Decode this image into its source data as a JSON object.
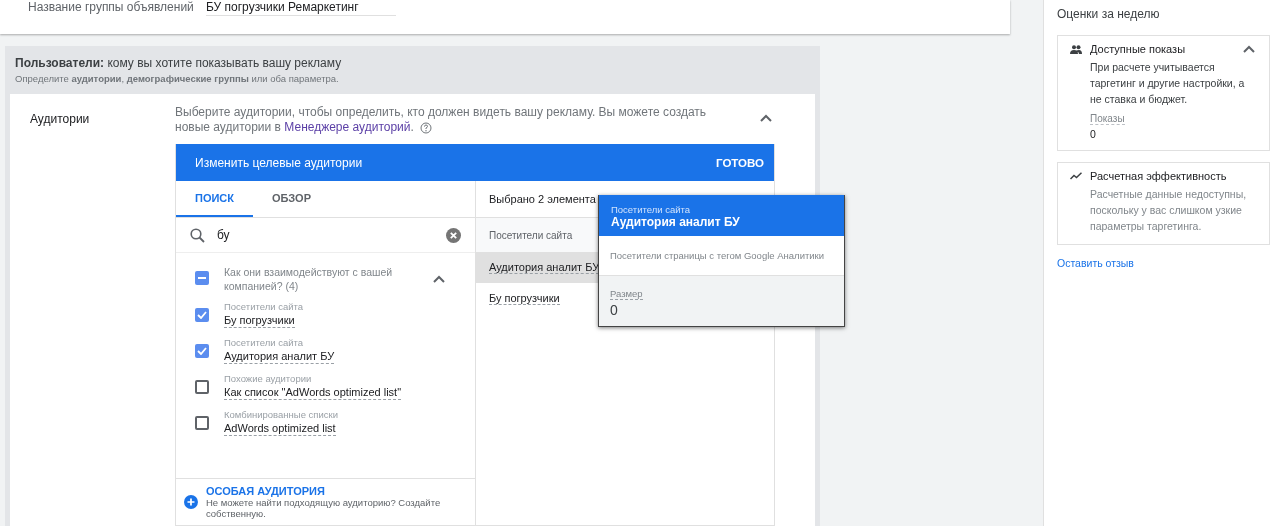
{
  "ad_group": {
    "label": "Название группы объявлений",
    "value": "БУ погрузчики Ремаркетинг"
  },
  "users_section": {
    "title": "**Пользователи:** кому вы хотите показывать вашу рекламу",
    "subtitle": "Определите **аудитории**, **демографические группы** или оба параметра."
  },
  "audiences": {
    "label": "Аудитории",
    "description": "Выберите аудитории, чтобы определить, кто должен видеть вашу рекламу.  Вы можете создать новые аудитории в",
    "link": "Менеджере аудиторий",
    "after_link": ".",
    "expanded": true
  },
  "editor": {
    "title": "Изменить целевые аудитории",
    "done": "ГОТОВО",
    "tabs": [
      {
        "label": "ПОИСК",
        "selected": true
      },
      {
        "label": "ОБЗОР",
        "selected": false
      }
    ],
    "search": {
      "value": "бу"
    },
    "group": {
      "label": "Как они взаимодействуют с вашей компанией? (4)",
      "partial": true,
      "expanded": true
    },
    "items": [
      {
        "category": "Посетители сайта",
        "name": "Бу погрузчики",
        "checked": true
      },
      {
        "category": "Посетители сайта",
        "name": "Аудитория аналит БУ",
        "checked": true
      },
      {
        "category": "Похожие аудитории",
        "name": "Как список \"AdWords optimized list\"",
        "checked": false
      },
      {
        "category": "Комбинированные списки",
        "name": "AdWords optimized list",
        "checked": false
      }
    ],
    "custom": {
      "title": "ОСОБАЯ АУДИТОРИЯ",
      "text": "Не можете найти подходящую аудиторию? Создайте собственную."
    },
    "selected_panel": {
      "count": "Выбрано 2 элемента",
      "category": "Посетители сайта",
      "items": [
        {
          "name": "Аудитория аналит БУ",
          "selected": true
        },
        {
          "name": "Бу погрузчики",
          "selected": false
        }
      ]
    }
  },
  "popup": {
    "category": "Посетители сайта",
    "name": "Аудитория аналит БУ",
    "description": "Посетители страницы с тегом Google Аналитики",
    "size_label": "Размер",
    "size_value": "0"
  },
  "sidebar": {
    "title": "Оценки за неделю",
    "cards": [
      {
        "kind": "reach",
        "title": "Доступные показы",
        "text": "При расчете учитывается таргетинг и другие настройки, а не ставка и бюджет.",
        "metric_label": "Показы",
        "metric_value": "0",
        "expanded": true
      },
      {
        "kind": "performance",
        "title": "Расчетная эффективность",
        "text": "Расчетные данные недоступны, поскольку у вас слишком узкие параметры таргетинга."
      }
    ],
    "feedback_link": "Оставить отзыв"
  }
}
